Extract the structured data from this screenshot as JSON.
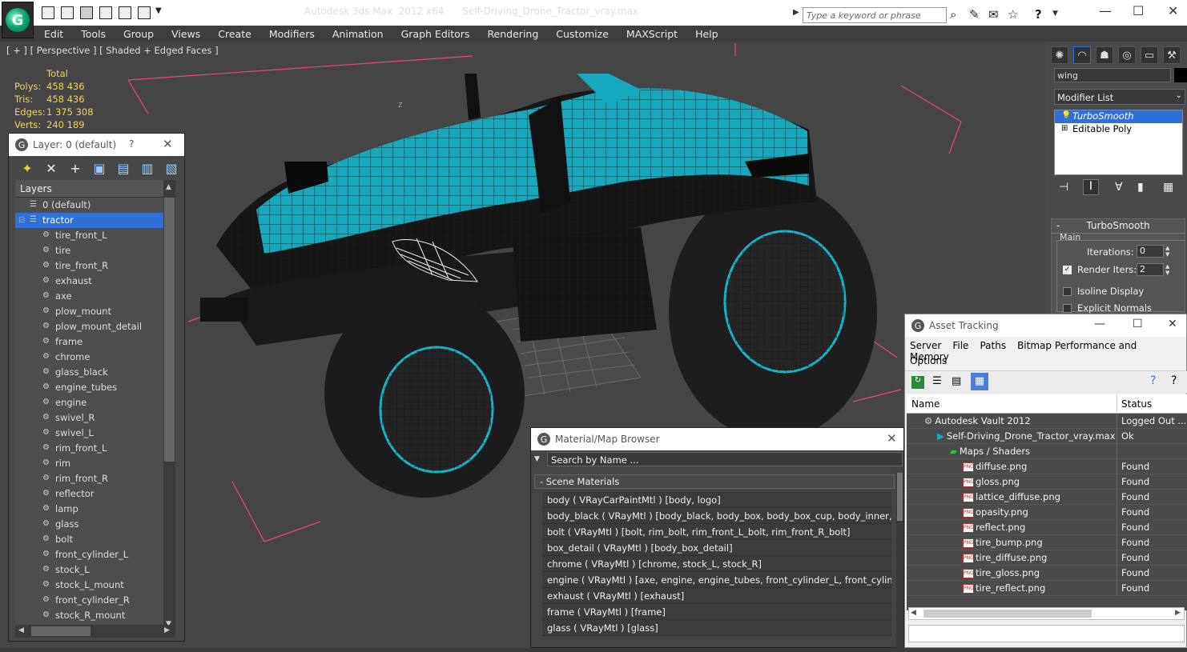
{
  "app": {
    "title": "Autodesk 3ds Max  2012 x64      Self-Driving_Drone_Tractor_vray.max",
    "search_placeholder": "Type a keyword or phrase"
  },
  "menu": [
    "Edit",
    "Tools",
    "Group",
    "Views",
    "Create",
    "Modifiers",
    "Animation",
    "Graph Editors",
    "Rendering",
    "Customize",
    "MAXScript",
    "Help"
  ],
  "viewport": {
    "label": "[ + ] [ Perspective ] [ Shaded + Edged Faces ]",
    "stats_header": "Total",
    "stats": [
      {
        "k": "Polys:",
        "v": "458 436"
      },
      {
        "k": "Tris:",
        "v": "458 436"
      },
      {
        "k": "Edges:",
        "v": "1 375 308"
      },
      {
        "k": "Verts:",
        "v": "240 189"
      }
    ],
    "axis_label": "Z"
  },
  "command_panel": {
    "object_name": "wing",
    "modifier_list": "Modifier List",
    "stack": [
      "TurboSmooth",
      "Editable Poly"
    ],
    "rollout_title": "TurboSmooth",
    "group_main": "Main",
    "iterations_label": "Iterations:",
    "iterations_value": "0",
    "render_iters_label": "Render Iters:",
    "render_iters_value": "2",
    "isoline_label": "Isoline Display",
    "explicit_label": "Explicit Normals"
  },
  "layers": {
    "title": "Layer: 0 (default)",
    "help": "?",
    "header": "Layers",
    "items": [
      {
        "name": "0 (default)",
        "top": true
      },
      {
        "name": "tractor",
        "top": true,
        "selected": true
      },
      {
        "name": "tire_front_L"
      },
      {
        "name": "tire"
      },
      {
        "name": "tire_front_R"
      },
      {
        "name": "exhaust"
      },
      {
        "name": "axe"
      },
      {
        "name": "plow_mount"
      },
      {
        "name": "plow_mount_detail"
      },
      {
        "name": "frame"
      },
      {
        "name": "chrome"
      },
      {
        "name": "glass_black"
      },
      {
        "name": "engine_tubes"
      },
      {
        "name": "engine"
      },
      {
        "name": "swivel_R"
      },
      {
        "name": "swivel_L"
      },
      {
        "name": "rim_front_L"
      },
      {
        "name": "rim"
      },
      {
        "name": "rim_front_R"
      },
      {
        "name": "reflector"
      },
      {
        "name": "lamp"
      },
      {
        "name": "glass"
      },
      {
        "name": "bolt"
      },
      {
        "name": "front_cylinder_L"
      },
      {
        "name": "stock_L"
      },
      {
        "name": "stock_L_mount"
      },
      {
        "name": "front_cylinder_R"
      },
      {
        "name": "stock_R_mount"
      }
    ]
  },
  "material_browser": {
    "title": "Material/Map Browser",
    "search_placeholder": "Search by Name ...",
    "section": "- Scene Materials",
    "items": [
      "body  ( VRayCarPaintMtl ) [body, logo]",
      "body_black  ( VRayMtl ) [body_black, body_box, body_box_cup, body_inner, sea...",
      "bolt  ( VRayMtl ) [bolt, rim_bolt, rim_front_L_bolt, rim_front_R_bolt]",
      "box_detail  ( VRayMtl ) [body_box_detail]",
      "chrome  ( VRayMtl ) [chrome, stock_L, stock_R]",
      "engine  ( VRayMtl ) [axe, engine, engine_tubes, front_cylinder_L, front_cylinder_R...",
      "exhaust  ( VRayMtl ) [exhaust]",
      "frame  ( VRayMtl ) [frame]",
      "glass  ( VRayMtl ) [glass]"
    ]
  },
  "asset_tracking": {
    "title": "Asset Tracking",
    "menu": [
      "Server",
      "File",
      "Paths",
      "Bitmap Performance and Memory"
    ],
    "menu2": "Options",
    "col_name": "Name",
    "col_status": "Status",
    "rows": [
      {
        "name": "Autodesk Vault 2012",
        "status": "Logged Out ...",
        "indent": 1,
        "icon": "vault"
      },
      {
        "name": "Self-Driving_Drone_Tractor_vray.max",
        "status": "Ok",
        "indent": 2,
        "icon": "max"
      },
      {
        "name": "Maps / Shaders",
        "status": "",
        "indent": 3,
        "icon": "maps"
      },
      {
        "name": "diffuse.png",
        "status": "Found",
        "indent": 4,
        "icon": "png"
      },
      {
        "name": "gloss.png",
        "status": "Found",
        "indent": 4,
        "icon": "png"
      },
      {
        "name": "lattice_diffuse.png",
        "status": "Found",
        "indent": 4,
        "icon": "png"
      },
      {
        "name": "opasity.png",
        "status": "Found",
        "indent": 4,
        "icon": "png"
      },
      {
        "name": "reflect.png",
        "status": "Found",
        "indent": 4,
        "icon": "png"
      },
      {
        "name": "tire_bump.png",
        "status": "Found",
        "indent": 4,
        "icon": "png"
      },
      {
        "name": "tire_diffuse.png",
        "status": "Found",
        "indent": 4,
        "icon": "png"
      },
      {
        "name": "tire_gloss.png",
        "status": "Found",
        "indent": 4,
        "icon": "png"
      },
      {
        "name": "tire_reflect.png",
        "status": "Found",
        "indent": 4,
        "icon": "png"
      }
    ]
  },
  "colors": {
    "accent": "#2e6fd8",
    "body_cyan": "#16a9bd",
    "stat_yellow": "#f3d35a",
    "bbox_pink": "#e7467a"
  }
}
